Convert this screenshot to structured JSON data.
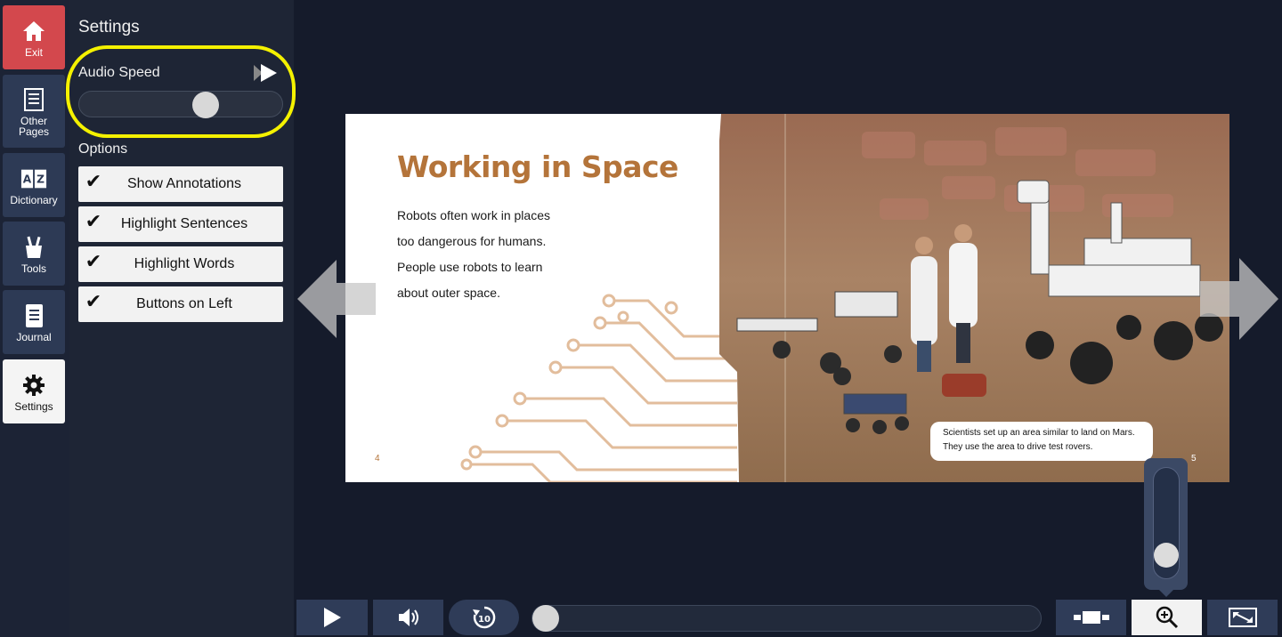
{
  "rail": {
    "exit": {
      "label": "Exit",
      "icon": "home-icon"
    },
    "other_pages": {
      "label": "Other\nPages",
      "icon": "list-icon"
    },
    "dictionary": {
      "label": "Dictionary",
      "icon": "dictionary-az-icon"
    },
    "tools": {
      "label": "Tools",
      "icon": "tools-cup-icon"
    },
    "journal": {
      "label": "Journal",
      "icon": "journal-icon"
    },
    "settings": {
      "label": "Settings",
      "icon": "gear-icon"
    }
  },
  "settings": {
    "title": "Settings",
    "audio_speed_label": "Audio Speed",
    "audio_speed_value": 0.64,
    "options_label": "Options",
    "options": [
      {
        "label": "Show Annotations",
        "checked": true
      },
      {
        "label": "Highlight Sentences",
        "checked": true
      },
      {
        "label": "Highlight Words",
        "checked": true
      },
      {
        "label": "Buttons on Left",
        "checked": true
      }
    ]
  },
  "book": {
    "title": "Working in Space",
    "body_lines": [
      "Robots often work in places",
      "too dangerous for humans.",
      "People use robots to learn",
      "about outer space."
    ],
    "page_left": "4",
    "page_right": "5",
    "caption": "Scientists set up an area similar to land on Mars. They use the area to drive test rovers."
  },
  "zoom": {
    "level": 0.12
  },
  "player": {
    "progress": 0.0
  },
  "colors": {
    "exit": "#d3484d",
    "title_brown": "#b4743a",
    "highlight": "#f4f100"
  }
}
